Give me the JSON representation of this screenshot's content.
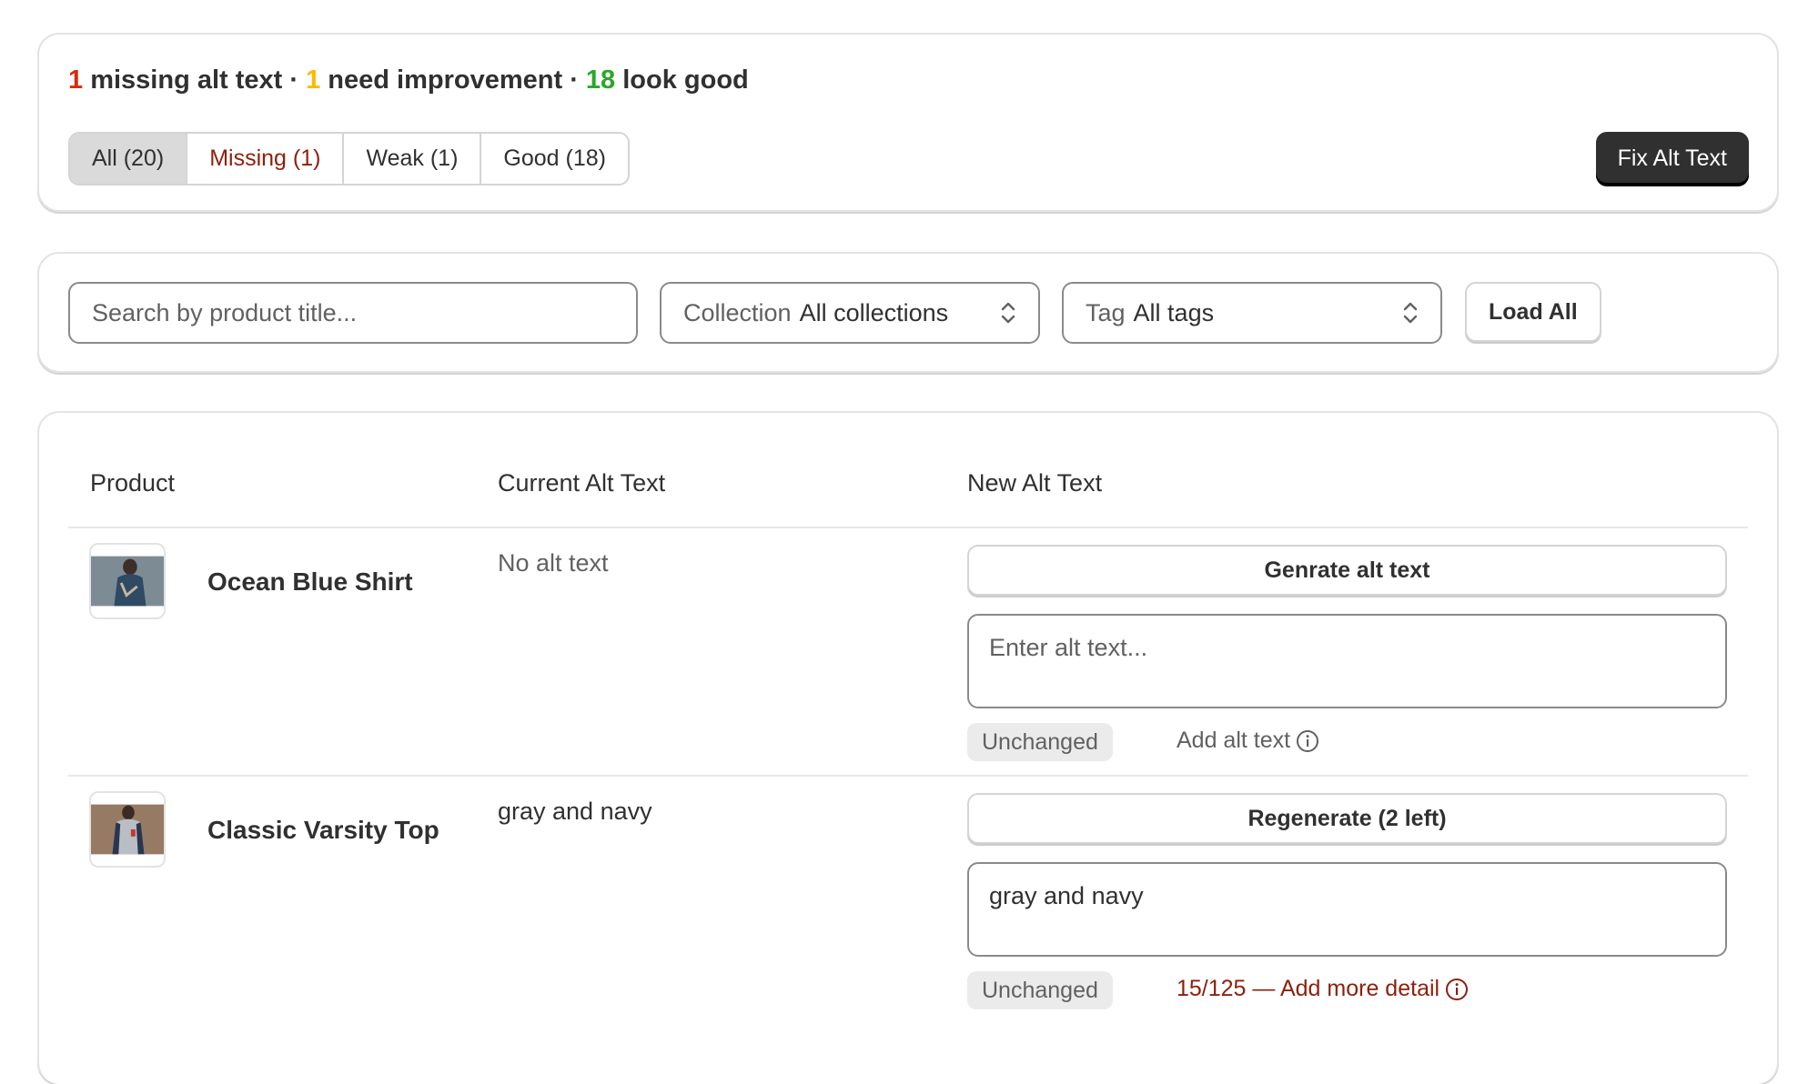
{
  "summary": {
    "missing_count": "1",
    "missing_label": " missing alt text · ",
    "weak_count": "1",
    "weak_label": " need improvement · ",
    "good_count": "18",
    "good_label": " look good"
  },
  "filter_tabs": [
    {
      "label": "All (20)",
      "active": true
    },
    {
      "label": "Missing (1)"
    },
    {
      "label": "Weak (1)"
    },
    {
      "label": "Good (18)"
    }
  ],
  "fix_button": "Fix Alt Text",
  "search": {
    "placeholder": "Search by product title..."
  },
  "collection_select": {
    "label": "Collection",
    "value": "All collections"
  },
  "tag_select": {
    "label": "Tag",
    "value": "All tags"
  },
  "load_all_button": "Load All",
  "table": {
    "headers": {
      "product": "Product",
      "current": "Current Alt Text",
      "new": "New Alt Text"
    },
    "rows": [
      {
        "product": "Ocean Blue Shirt",
        "current_alt": "No alt text",
        "action_button": "Genrate alt text",
        "new_alt_value": "",
        "new_alt_placeholder": "Enter alt text...",
        "status_badge": "Unchanged",
        "hint": "Add alt text"
      },
      {
        "product": "Classic Varsity Top",
        "current_alt": "gray and navy",
        "action_button": "Regenerate (2 left)",
        "new_alt_value": "gray and navy",
        "new_alt_placeholder": "",
        "status_badge": "Unchanged",
        "hint": "15/125 — Add more detail"
      }
    ]
  },
  "colors": {
    "missing": "#d72c0d",
    "weak": "#ffb800",
    "good": "#29a829",
    "hint_red": "#8e1f0b",
    "primary": "#303030"
  }
}
